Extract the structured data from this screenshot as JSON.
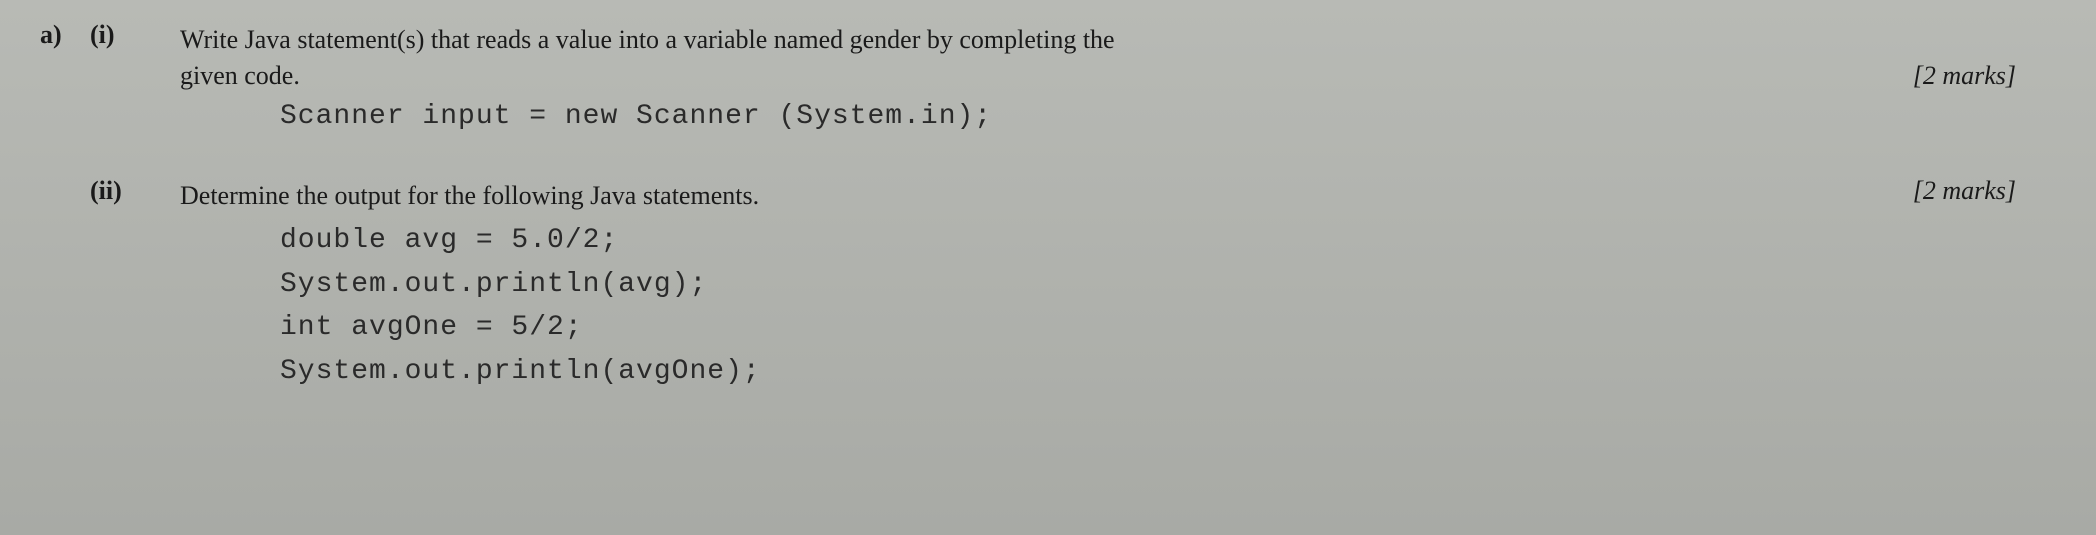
{
  "question": {
    "label_a": "a)",
    "parts": [
      {
        "label": "(i)",
        "text_line1": "Write Java statement(s) that reads a value into a variable named gender by completing the",
        "text_line2": "given code.",
        "marks": "[2 marks]",
        "code": [
          "Scanner input = new Scanner (System.in);"
        ]
      },
      {
        "label": "(ii)",
        "text_line1": "Determine the output for the following Java statements.",
        "marks": "[2 marks]",
        "code": [
          "double avg = 5.0/2;",
          "System.out.println(avg);",
          "int avgOne = 5/2;",
          "System.out.println(avgOne);"
        ]
      }
    ]
  }
}
